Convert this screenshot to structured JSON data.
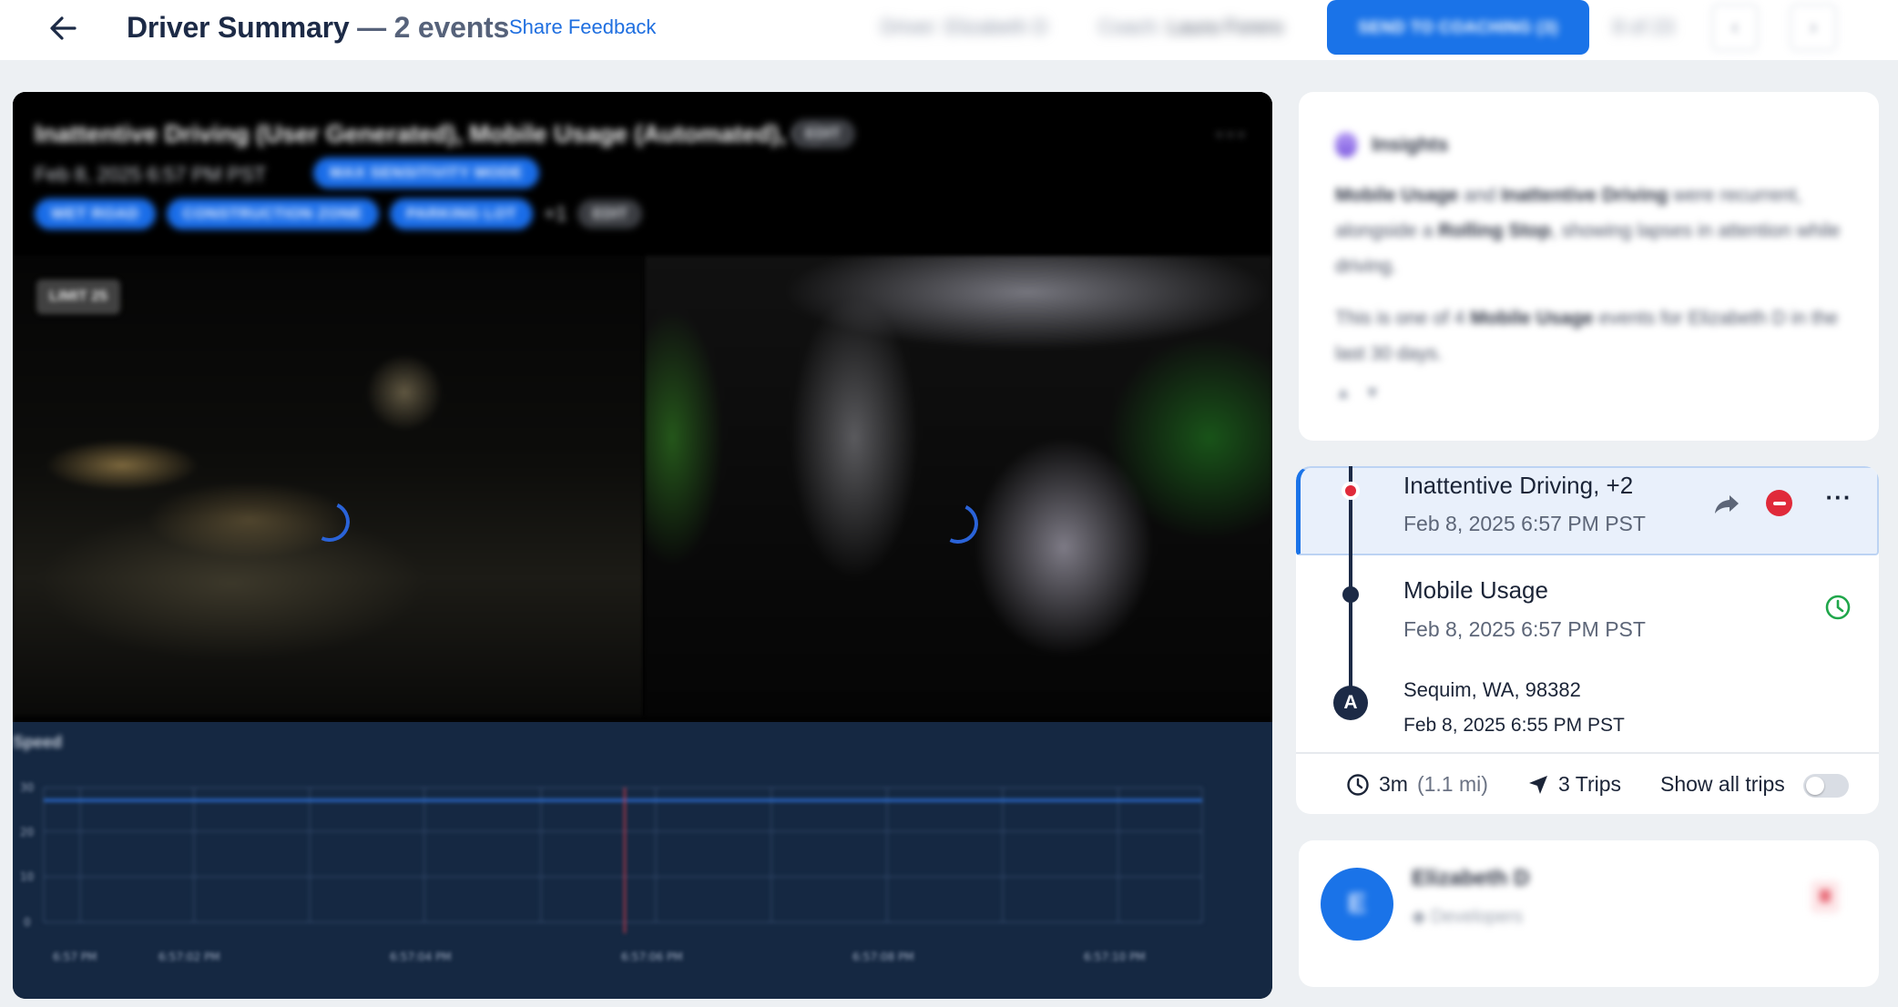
{
  "header": {
    "title": "Driver Summary",
    "events_suffix": "— 2 events",
    "share_feedback": "Share Feedback",
    "driver_meta": "Driver: Elizabeth D",
    "coach_label": "Coach:",
    "coach_name": "Laura Forero",
    "send_button": "SEND TO COACHING (3)",
    "pager": "8 of 23",
    "prev_icon": "chevron-left-icon",
    "next_icon": "chevron-right-icon",
    "back_icon": "arrow-left-icon"
  },
  "video": {
    "event_title": "Inattentive Driving (User Generated), Mobile Usage (Automated), +1",
    "edit_label": "EDIT",
    "event_date": "Feb 8, 2025 6:57 PM PST",
    "sensitivity_pill": "MAX SENSITIVITY MODE",
    "tags": [
      "WET ROAD",
      "CONSTRUCTION ZONE",
      "PARKING LOT"
    ],
    "tags_more": "+1",
    "tags_edit": "EDIT",
    "limit_badge": "LIMIT 25",
    "menu_icon": "more-horizontal-icon"
  },
  "speed_chart": {
    "label": "Speed",
    "y_ticks": [
      "30",
      "20",
      "10",
      "0"
    ],
    "x_ticks": [
      "6:57 PM",
      "6:57:02 PM",
      "6:57:04 PM",
      "6:57:06 PM",
      "6:57:08 PM",
      "6:57:10 PM"
    ]
  },
  "insights": {
    "title": "Insights",
    "p1_b1": "Mobile Usage",
    "p1_t1": " and ",
    "p1_b2": "Inattentive Driving",
    "p1_t2": " were recurrent, alongside a ",
    "p1_b3": "Rolling Stop",
    "p1_t3": ", showing lapses in attention while driving.",
    "p2_t1": "This is one of 4 ",
    "p2_b1": "Mobile Usage",
    "p2_t2": " events for Elizabeth D in the last 30 days."
  },
  "timeline": {
    "events": [
      {
        "title": "Inattentive Driving, +2",
        "date": "Feb 8, 2025 6:57 PM PST"
      },
      {
        "title": "Mobile Usage",
        "date": "Feb 8, 2025 6:57 PM PST"
      }
    ],
    "start_marker": "A",
    "start_location": "Sequim, WA, 98382",
    "start_date": "Feb 8, 2025 6:55 PM PST",
    "duration": "3m",
    "distance": "(1.1 mi)",
    "trips": "3 Trips",
    "show_all_trips": "Show all trips",
    "show_all_trips_on": false
  },
  "driver": {
    "initial": "E",
    "name": "Elizabeth D",
    "group": "Developers"
  },
  "colors": {
    "accent": "#1a73e8",
    "danger": "#e02a3a",
    "success": "#1fa64a",
    "navy": "#1c2a46",
    "chart_bg": "#152842"
  }
}
